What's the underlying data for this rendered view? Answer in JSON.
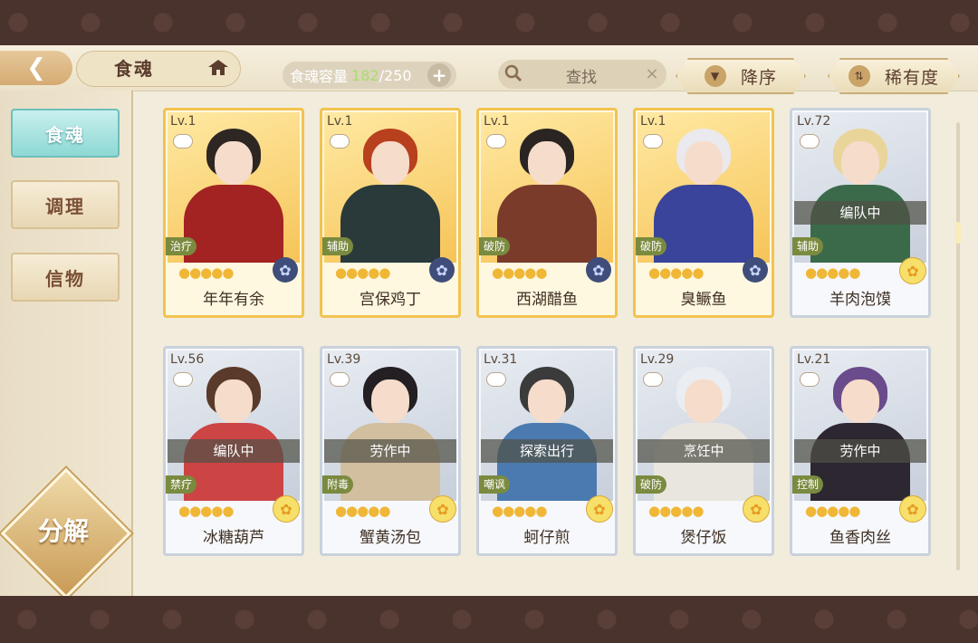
{
  "header": {
    "back_icon": "back-chevron-icon",
    "title": "食魂",
    "capacity_label": "食魂容量",
    "capacity_current": "182",
    "capacity_sep": "/250",
    "plus_label": "+",
    "search_label": "查找",
    "clear_label": "×",
    "sort_order_label": "降序",
    "sort_by_label": "稀有度"
  },
  "sidebar": {
    "tabs": [
      {
        "label": "食魂"
      },
      {
        "label": "调理"
      },
      {
        "label": "信物"
      }
    ],
    "decompose_label": "分解"
  },
  "cards": [
    {
      "lv": "Lv.1",
      "name": "年年有余",
      "role": "治疗",
      "status": "",
      "frame": "gold",
      "rarity": "blue"
    },
    {
      "lv": "Lv.1",
      "name": "宫保鸡丁",
      "role": "辅助",
      "status": "",
      "frame": "gold",
      "rarity": "blue"
    },
    {
      "lv": "Lv.1",
      "name": "西湖醋鱼",
      "role": "破防",
      "status": "",
      "frame": "gold",
      "rarity": "blue"
    },
    {
      "lv": "Lv.1",
      "name": "臭鳜鱼",
      "role": "破防",
      "status": "",
      "frame": "gold",
      "rarity": "blue"
    },
    {
      "lv": "Lv.72",
      "name": "羊肉泡馍",
      "role": "辅助",
      "status": "编队中",
      "frame": "silver",
      "rarity": "gold"
    },
    {
      "lv": "Lv.56",
      "name": "冰糖葫芦",
      "role": "禁疗",
      "status": "编队中",
      "frame": "silver",
      "rarity": "gold"
    },
    {
      "lv": "Lv.39",
      "name": "蟹黄汤包",
      "role": "附毒",
      "status": "劳作中",
      "frame": "silver",
      "rarity": "gold"
    },
    {
      "lv": "Lv.31",
      "name": "蚵仔煎",
      "role": "嘲讽",
      "status": "探索出行",
      "frame": "silver",
      "rarity": "gold"
    },
    {
      "lv": "Lv.29",
      "name": "煲仔饭",
      "role": "破防",
      "status": "烹饪中",
      "frame": "silver",
      "rarity": "gold"
    },
    {
      "lv": "Lv.21",
      "name": "鱼香肉丝",
      "role": "控制",
      "status": "劳作中",
      "frame": "silver",
      "rarity": "gold"
    }
  ],
  "colors": {
    "accent_teal": "#8dd8d4",
    "gold_frame": "#f1c350",
    "silver_frame": "#c9d1dc",
    "capacity_green": "#a9dd6b"
  }
}
